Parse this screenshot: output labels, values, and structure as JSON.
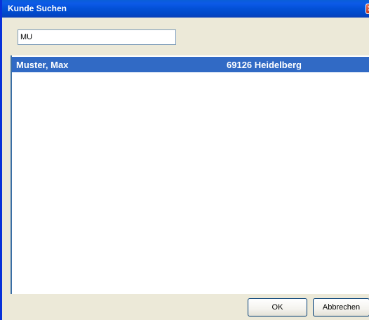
{
  "window": {
    "title": "Kunde Suchen",
    "close_icon": "close-icon"
  },
  "search": {
    "value": "MU"
  },
  "results": [
    {
      "name": "Muster, Max",
      "city": "69126 Heidelberg",
      "selected": true
    }
  ],
  "buttons": {
    "ok_label": "OK",
    "cancel_label": "Abbrechen"
  },
  "colors": {
    "selection": "#316ac5",
    "titlebar": "#0350d6",
    "dialog_bg": "#ece9d8"
  }
}
